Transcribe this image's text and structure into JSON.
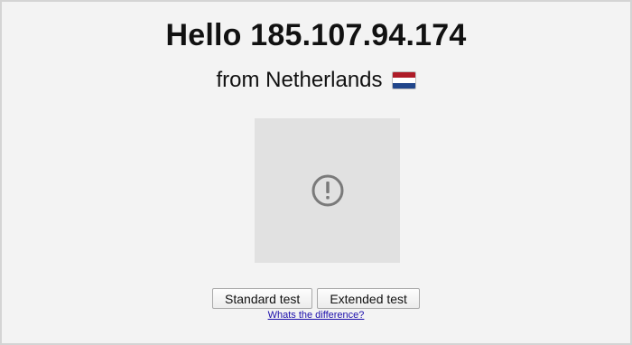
{
  "greeting": "Hello 185.107.94.174",
  "location": {
    "text": "from Netherlands",
    "flag": {
      "icon": "netherlands-flag-icon",
      "colors": [
        "#ae1c28",
        "#ffffff",
        "#21468b"
      ]
    }
  },
  "image_placeholder": {
    "icon": "alert-circle-icon",
    "icon_color": "#7a7a7a",
    "background": "#e1e1e1"
  },
  "buttons": {
    "standard_label": "Standard test",
    "extended_label": "Extended test"
  },
  "difference_link": "Whats the difference?"
}
